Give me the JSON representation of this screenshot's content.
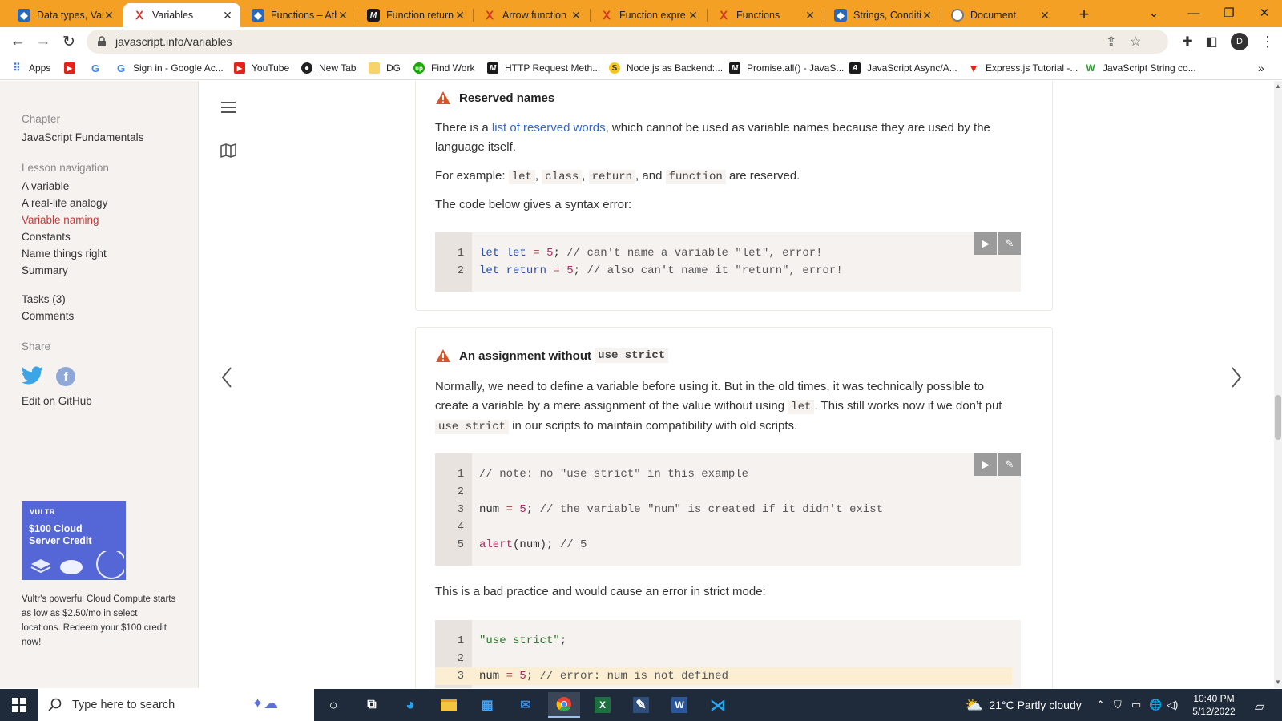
{
  "browser": {
    "tabs": [
      {
        "title": "Data types, Var",
        "icon": "javascript-info-icon"
      },
      {
        "title": "Variables",
        "icon": "javascript-info-icon",
        "active": true
      },
      {
        "title": "Functions – Ath",
        "icon": "javascript-info-icon"
      },
      {
        "title": "Function return",
        "icon": "mdn-icon"
      },
      {
        "title": "Arrow function",
        "icon": "javascript-info-icon"
      },
      {
        "title": "Function expre",
        "icon": "javascript-info-icon"
      },
      {
        "title": "Functions",
        "icon": "javascript-info-icon"
      },
      {
        "title": "Strings, Conditi",
        "icon": "javascript-info-icon"
      },
      {
        "title": "Document",
        "icon": "globe-icon"
      }
    ],
    "url": "javascript.info/variables",
    "profile_initial": "D",
    "bookmarks": [
      {
        "label": "Apps"
      },
      {
        "label": ""
      },
      {
        "label": ""
      },
      {
        "label": "Sign in - Google Ac..."
      },
      {
        "label": "YouTube"
      },
      {
        "label": "New Tab"
      },
      {
        "label": "DG"
      },
      {
        "label": "Find Work"
      },
      {
        "label": "HTTP Request Meth..."
      },
      {
        "label": "Node.js as Backend:..."
      },
      {
        "label": "Promise.all() - JavaS..."
      },
      {
        "label": "JavaScript Async/A..."
      },
      {
        "label": "Express.js Tutorial -..."
      },
      {
        "label": "JavaScript String co..."
      }
    ],
    "bookmarks_overflow": "»"
  },
  "sidebar": {
    "chapter_label": "Chapter",
    "chapter_name": "JavaScript Fundamentals",
    "lesson_nav_label": "Lesson navigation",
    "lesson_links": [
      {
        "label": "A variable"
      },
      {
        "label": "A real-life analogy"
      },
      {
        "label": "Variable naming",
        "current": true
      },
      {
        "label": "Constants"
      },
      {
        "label": "Name things right"
      },
      {
        "label": "Summary"
      }
    ],
    "tasks": "Tasks (3)",
    "comments": "Comments",
    "share_label": "Share",
    "edit_github": "Edit on GitHub",
    "ad": {
      "brand": "VULTR",
      "headline_1": "$100 Cloud",
      "headline_2": "Server Credit",
      "text": "Vultr's powerful Cloud Compute starts as low as $2.50/mo in select locations. Redeem your $100 credit now!"
    }
  },
  "content": {
    "card1": {
      "title": "Reserved names",
      "p1_before": "There is a ",
      "p1_link": "list of reserved words",
      "p1_after": ", which cannot be used as variable names because they are used by the language itself.",
      "p2_start": "For example: ",
      "p2_codes": [
        "let",
        "class",
        "return"
      ],
      "p2_and": ", and ",
      "p2_code4": "function",
      "p2_end": " are reserved.",
      "p3": "The code below gives a syntax error:",
      "code_lines": [
        {
          "num": "1",
          "text": "let let = 5; // can't name a variable \"let\", error!"
        },
        {
          "num": "2",
          "text": "let return = 5; // also can't name it \"return\", error!"
        }
      ]
    },
    "card2": {
      "title": "An assignment without",
      "title_code": "use strict",
      "p1_a": "Normally, we need to define a variable before using it. But in the old times, it was technically possible to create a variable by a mere assignment of the value without using ",
      "p1_code1": "let",
      "p1_b": ". This still works now if we don’t put ",
      "p1_code2": "use strict",
      "p1_c": " in our scripts to maintain compatibility with old scripts.",
      "code_lines": [
        {
          "num": "1",
          "text": "// note: no \"use strict\" in this example"
        },
        {
          "num": "2",
          "text": ""
        },
        {
          "num": "3",
          "text": "num = 5; // the variable \"num\" is created if it didn't exist"
        },
        {
          "num": "4",
          "text": ""
        },
        {
          "num": "5",
          "text": "alert(num); // 5"
        }
      ],
      "p2": "This is a bad practice and would cause an error in strict mode:",
      "code2_lines": [
        {
          "num": "1",
          "text": "\"use strict\";"
        },
        {
          "num": "2",
          "text": ""
        },
        {
          "num": "3",
          "text": "num = 5; // error: num is not defined"
        }
      ]
    }
  },
  "taskbar": {
    "search_placeholder": "Type here to search",
    "weather": "21°C  Partly cloudy",
    "time": "10:40 PM",
    "date": "5/12/2022"
  },
  "colors": {
    "tab_strip": "#f4a024",
    "link": "#3267c9",
    "current_nav": "#c33b3b",
    "warning": "#d9542b",
    "taskbar": "#1f2a3a"
  }
}
